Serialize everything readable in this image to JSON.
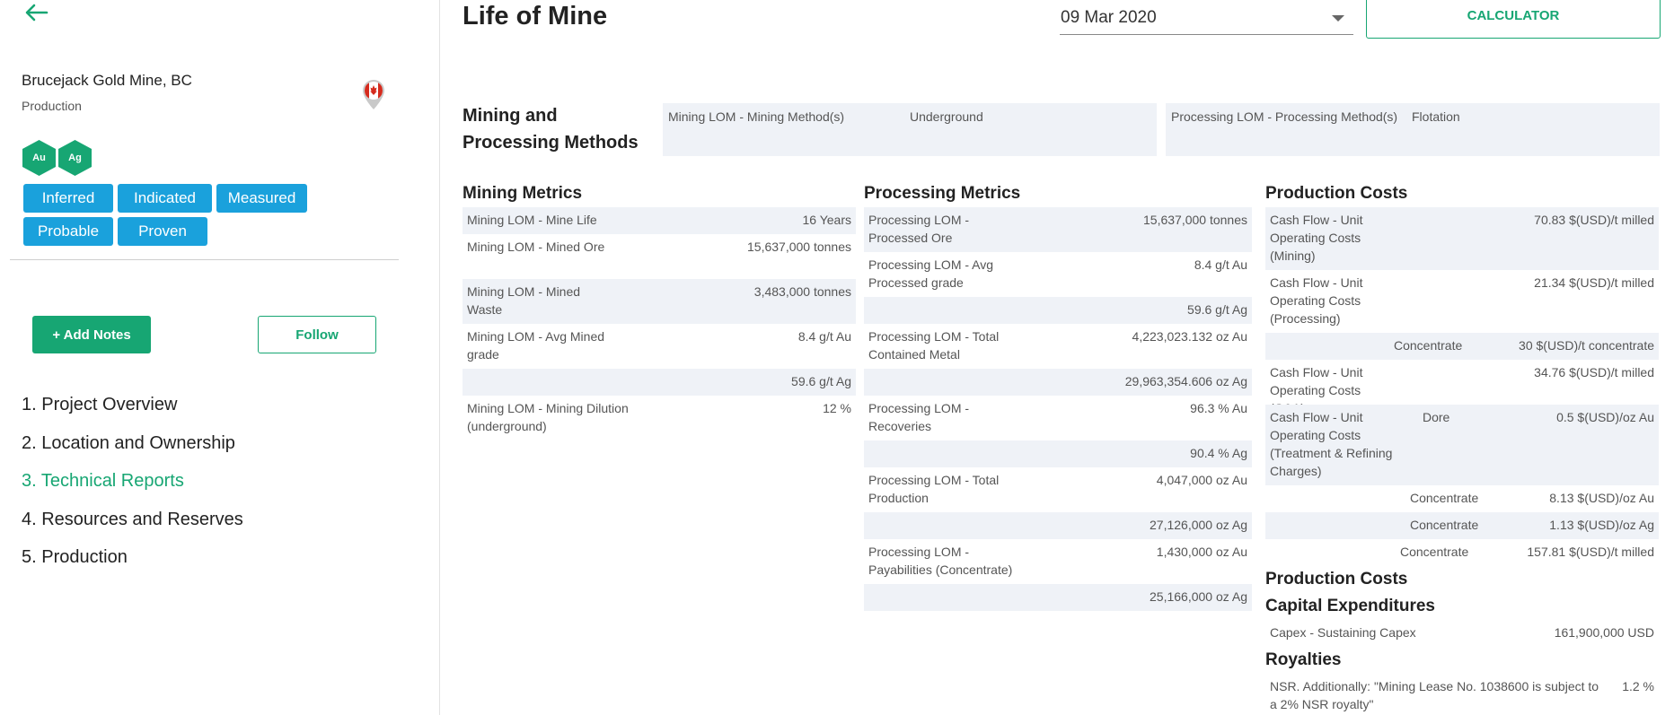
{
  "sidebar": {
    "mine_name": "Brucejack Gold Mine, BC",
    "mine_status": "Production",
    "commodities": [
      "Au",
      "Ag"
    ],
    "tags": [
      "Inferred",
      "Indicated",
      "Measured",
      "Probable",
      "Proven"
    ],
    "add_notes_label": "+ Add Notes",
    "follow_label": "Follow",
    "nav": [
      {
        "label": "1. Project Overview",
        "active": false
      },
      {
        "label": "2. Location and Ownership",
        "active": false
      },
      {
        "label": "3. Technical Reports",
        "active": true
      },
      {
        "label": "4. Resources and Reserves",
        "active": false
      },
      {
        "label": "5. Production",
        "active": false
      }
    ]
  },
  "header": {
    "title": "Life of Mine",
    "date": "09 Mar 2020",
    "calculator_label": "CALCULATOR"
  },
  "methods": {
    "title": "Mining and Processing Methods",
    "mining_label": "Mining LOM - Mining Method(s)",
    "mining_value": "Underground",
    "processing_label": "Processing LOM - Processing Method(s)",
    "processing_value": "Flotation"
  },
  "mining_metrics": {
    "title": "Mining Metrics",
    "rows": [
      {
        "label": "Mining LOM - Mine Life",
        "value": "16 Years"
      },
      {
        "label": "Mining LOM - Mined Ore",
        "value": "15,637,000 tonnes"
      },
      {
        "label": "Mining LOM - Mined Waste",
        "value": "3,483,000 tonnes"
      },
      {
        "label": "Mining LOM - Avg Mined grade",
        "value": "8.4 g/t Au"
      },
      {
        "label": "",
        "value": "59.6 g/t Ag"
      },
      {
        "label": "Mining LOM - Mining Dilution (underground)",
        "value": "12 %"
      }
    ]
  },
  "processing_metrics": {
    "title": "Processing Metrics",
    "rows": [
      {
        "label": "Processing LOM - Processed Ore",
        "value": "15,637,000 tonnes"
      },
      {
        "label": "Processing LOM - Avg Processed grade",
        "value": "8.4 g/t Au"
      },
      {
        "label": "",
        "value": "59.6 g/t Ag"
      },
      {
        "label": "Processing LOM - Total Contained Metal",
        "value": "4,223,023.132 oz Au"
      },
      {
        "label": "",
        "value": "29,963,354.606 oz Ag"
      },
      {
        "label": "Processing LOM - Recoveries",
        "value": "96.3 % Au"
      },
      {
        "label": "",
        "value": "90.4 % Ag"
      },
      {
        "label": "Processing LOM - Total Production",
        "value": "4,047,000 oz Au"
      },
      {
        "label": "",
        "value": "27,126,000 oz Ag"
      },
      {
        "label": "Processing LOM - Payabilities (Concentrate)",
        "value": "1,430,000 oz Au"
      },
      {
        "label": "",
        "value": "25,166,000 oz Ag"
      }
    ]
  },
  "production_costs": {
    "title": "Production Costs",
    "rows": [
      {
        "label": "Cash Flow - Unit Operating Costs (Mining)",
        "mid": "",
        "value": "70.83 $(USD)/t milled"
      },
      {
        "label": "Cash Flow - Unit Operating Costs (Processing)",
        "mid": "",
        "value": "21.34 $(USD)/t milled"
      },
      {
        "label": "",
        "mid": "Concentrate",
        "value": "30 $(USD)/t concentrate"
      },
      {
        "label": "Cash Flow - Unit Operating Costs (G&A)",
        "mid": "",
        "value": "34.76 $(USD)/t milled"
      },
      {
        "label": "Cash Flow - Unit Operating Costs (Treatment & Refining Charges)",
        "mid": "Dore",
        "value": "0.5 $(USD)/oz Au"
      },
      {
        "label": "",
        "mid": "Concentrate",
        "value": "8.13 $(USD)/oz Au"
      },
      {
        "label": "",
        "mid": "Concentrate",
        "value": "1.13 $(USD)/oz Ag"
      },
      {
        "label": "",
        "mid": "Concentrate",
        "value": "157.81 $(USD)/t milled"
      }
    ],
    "second_title": "Production Costs",
    "capex_title": "Capital Expenditures",
    "capex_label": "Capex - Sustaining Capex",
    "capex_value": "161,900,000 USD",
    "royalties_title": "Royalties",
    "royalty_label": "NSR. Additionally: \"Mining Lease No. 1038600 is subject to a 2% NSR royalty\"",
    "royalty_value": "1.2 %"
  },
  "colors": {
    "accent_green": "#17a673",
    "tag_blue": "#1aa1dc",
    "row_alt": "#eff2f7"
  }
}
